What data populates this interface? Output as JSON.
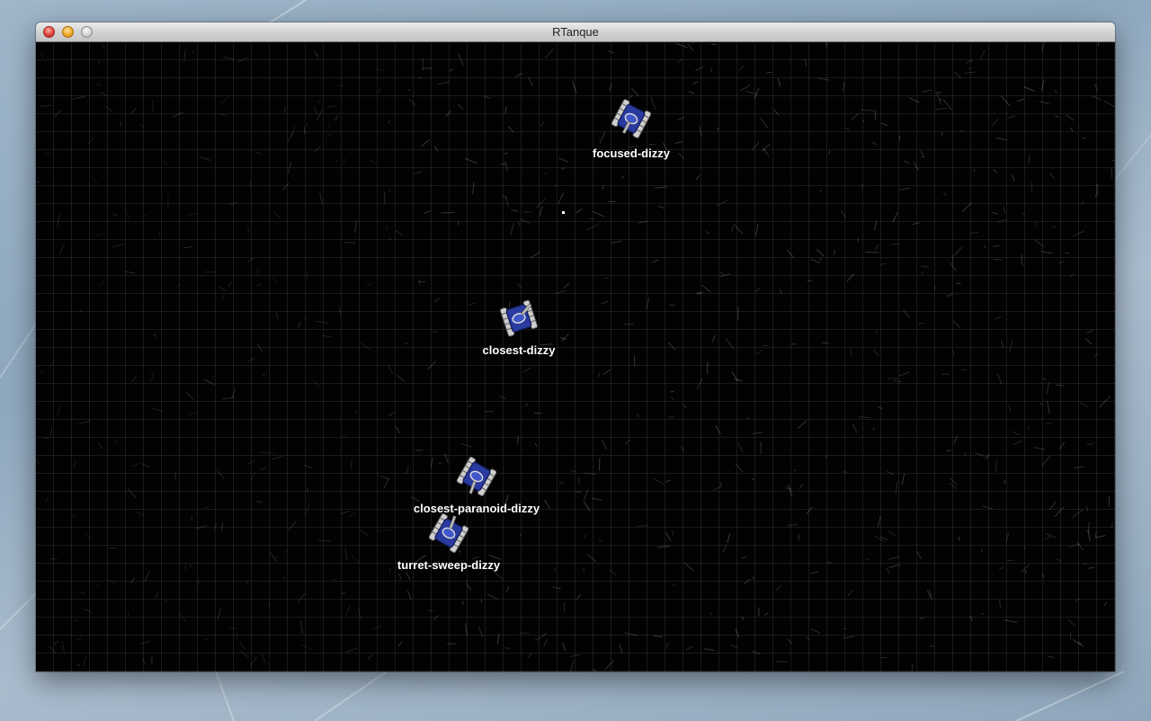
{
  "window": {
    "title": "RTanque",
    "controls": [
      "close",
      "minimize",
      "zoom"
    ]
  },
  "arena": {
    "background": "#020202",
    "grid_color": "rgba(255,255,255,0.09)"
  },
  "bots": [
    {
      "name": "focused-dizzy",
      "body_color": "#2a3a9e",
      "icon": "tank-icon"
    },
    {
      "name": "closest-dizzy",
      "body_color": "#2a3a9e",
      "icon": "tank-icon"
    },
    {
      "name": "closest-paranoid-dizzy",
      "body_color": "#2a3a9e",
      "icon": "tank-icon"
    },
    {
      "name": "turret-sweep-dizzy",
      "body_color": "#2a3a9e",
      "icon": "tank-icon"
    }
  ],
  "shells": [
    {
      "icon": "shell-dot"
    }
  ]
}
